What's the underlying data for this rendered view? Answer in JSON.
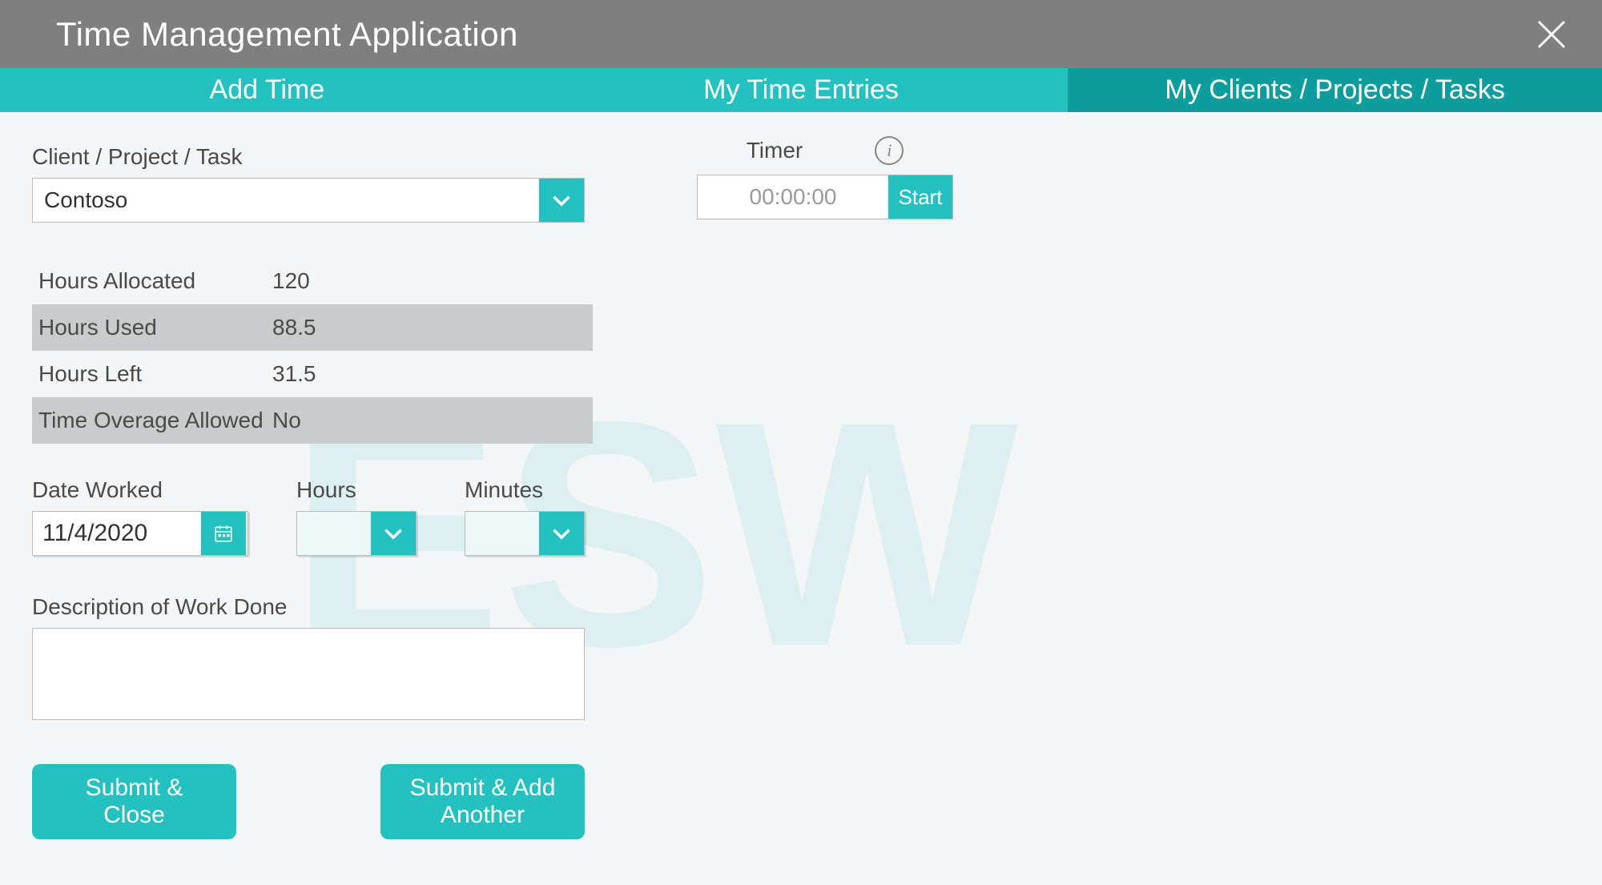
{
  "app": {
    "title": "Time Management Application"
  },
  "tabs": {
    "add_time": "Add Time",
    "my_entries": "My Time Entries",
    "my_clients": "My Clients / Projects / Tasks"
  },
  "client_task": {
    "label": "Client / Project / Task",
    "value": "Contoso"
  },
  "stats": {
    "hours_allocated": {
      "label": "Hours Allocated",
      "value": "120"
    },
    "hours_used": {
      "label": "Hours Used",
      "value": "88.5"
    },
    "hours_left": {
      "label": "Hours Left",
      "value": "31.5"
    },
    "overage": {
      "label": "Time Overage Allowed",
      "value": "No"
    }
  },
  "date_worked": {
    "label": "Date Worked",
    "value": "11/4/2020"
  },
  "hours": {
    "label": "Hours",
    "value": ""
  },
  "minutes": {
    "label": "Minutes",
    "value": ""
  },
  "description": {
    "label": "Description of Work Done",
    "value": ""
  },
  "buttons": {
    "submit_close": "Submit & Close",
    "submit_add": "Submit & Add Another"
  },
  "timer": {
    "label": "Timer",
    "value": "00:00:00",
    "start": "Start"
  },
  "colors": {
    "teal": "#25c1c1",
    "teal_dark": "#0e9d9d",
    "titlebar": "#7f7f7f"
  },
  "watermark": "ESW"
}
